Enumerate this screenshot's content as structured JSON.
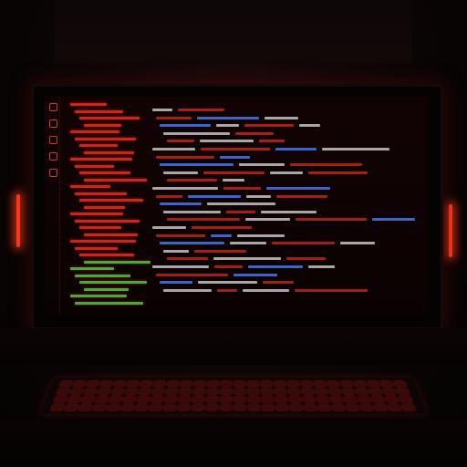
{
  "scene": {
    "description_type": "dark room with monitor showing red-themed code editor",
    "colors": {
      "accent": "#ff3a20",
      "code_red": "#c8271e",
      "code_white": "#cfcfcf",
      "code_blue": "#4a7cff",
      "code_green": "#3fae3f"
    }
  },
  "icons": [
    "file-icon",
    "search-icon",
    "branch-icon",
    "debug-icon",
    "extensions-icon"
  ]
}
